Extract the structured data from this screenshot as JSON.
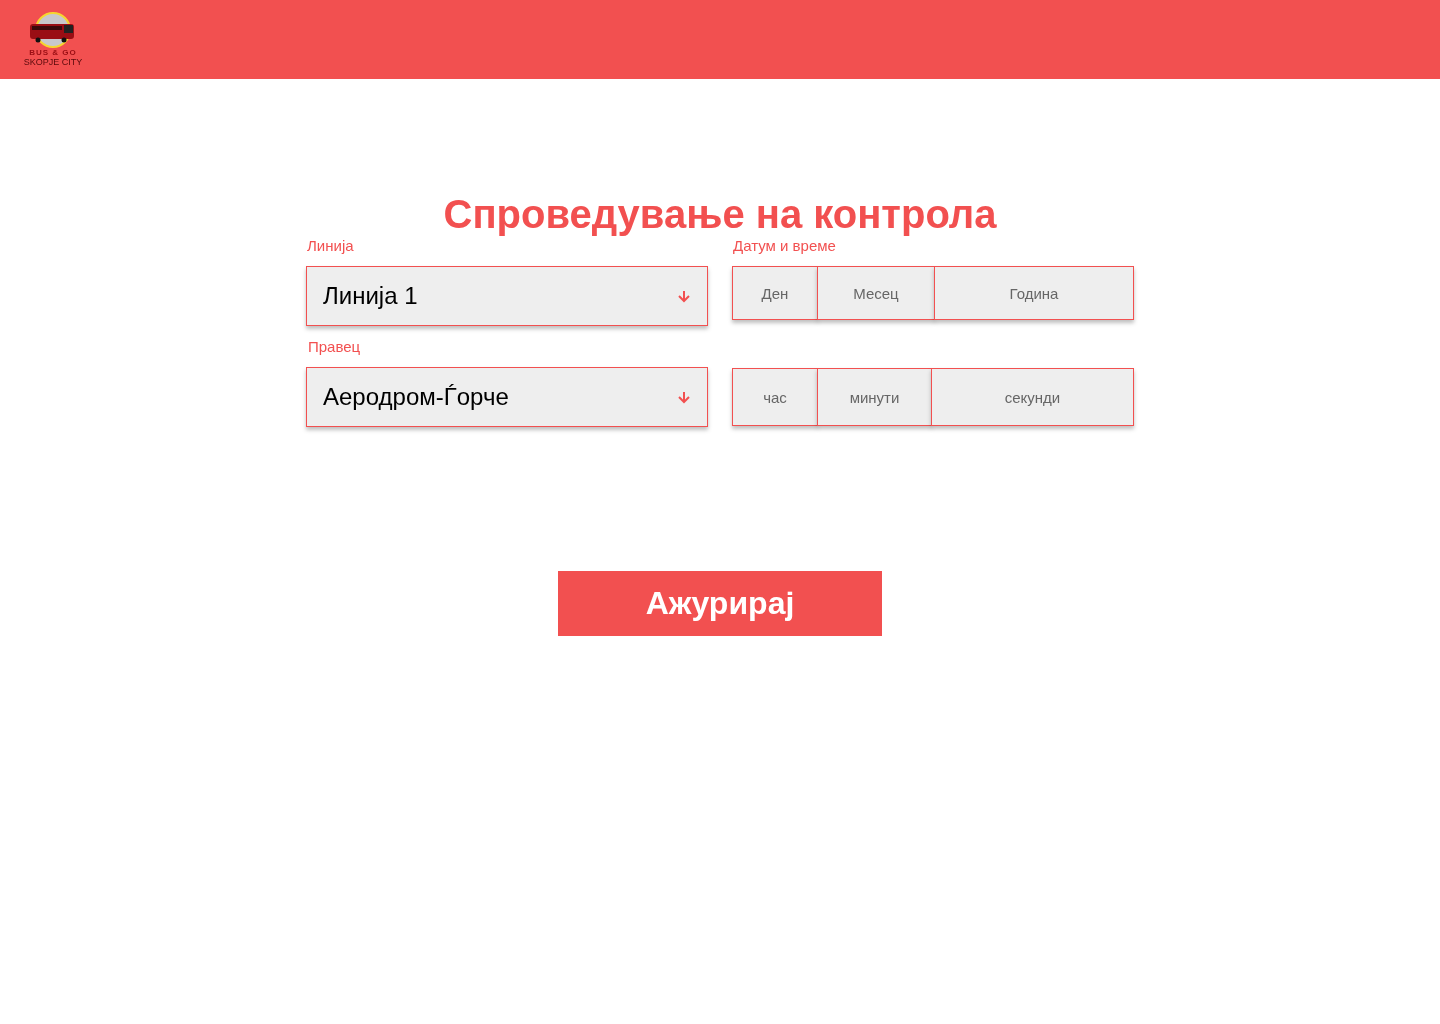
{
  "header": {
    "logo": {
      "name": "BUS & GO",
      "tagline": "SKOPJE CITY"
    }
  },
  "title": "Спроведување на контрола",
  "line": {
    "label": "Линија",
    "value": "Линија 1"
  },
  "direction": {
    "label": "Правец",
    "value": "Аеродром-Ѓорче"
  },
  "datetime": {
    "label": "Датум и време",
    "date_fields": [
      {
        "placeholder": "Ден"
      },
      {
        "placeholder": "Месец"
      },
      {
        "placeholder": "Година"
      }
    ],
    "time_fields": [
      {
        "placeholder": "час"
      },
      {
        "placeholder": "минути"
      },
      {
        "placeholder": "секунди"
      }
    ]
  },
  "button": "Ажурирај"
}
